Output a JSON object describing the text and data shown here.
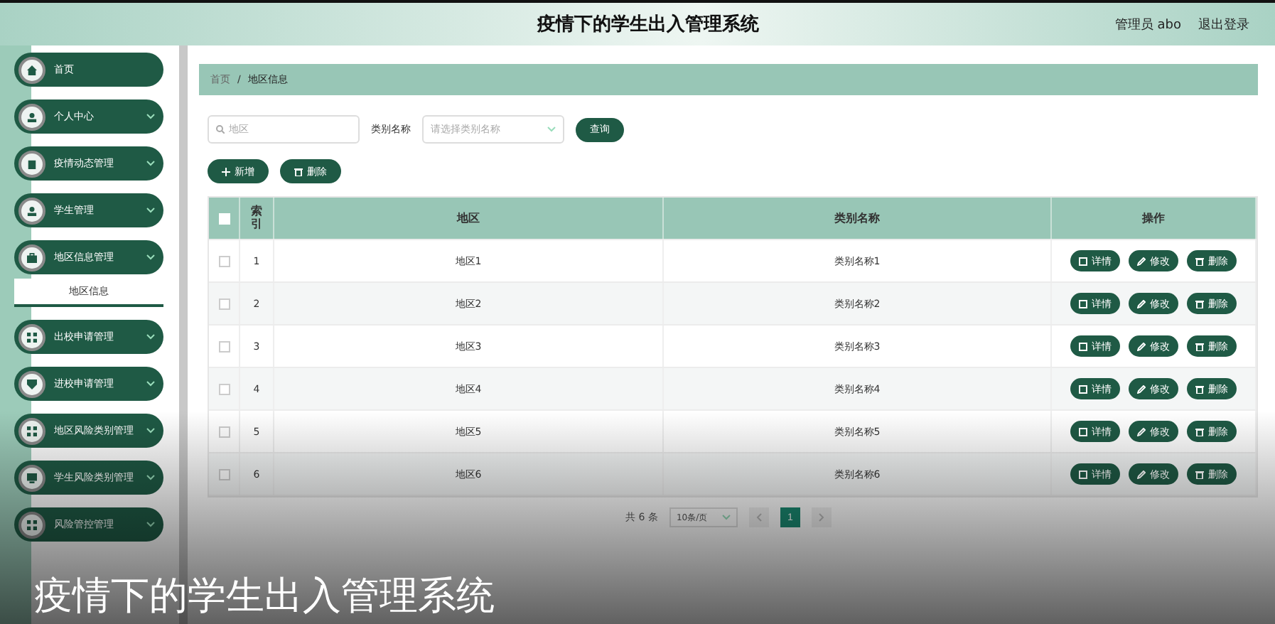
{
  "header": {
    "title": "疫情下的学生出入管理系统",
    "user": "管理员 abo",
    "logout": "退出登录"
  },
  "sidebar": {
    "items": [
      {
        "label": "首页"
      },
      {
        "label": "个人中心"
      },
      {
        "label": "疫情动态管理"
      },
      {
        "label": "学生管理"
      },
      {
        "label": "地区信息管理",
        "children": [
          {
            "label": "地区信息",
            "selected": true
          }
        ]
      },
      {
        "label": "出校申请管理"
      },
      {
        "label": "进校申请管理"
      },
      {
        "label": "地区风险类别管理"
      },
      {
        "label": "学生风险类别管理"
      },
      {
        "label": "风险管控管理"
      }
    ]
  },
  "breadcrumb": {
    "items": [
      "首页",
      "地区信息"
    ],
    "separator": "/"
  },
  "search": {
    "placeholder": "地区",
    "category_label": "类别名称",
    "category_placeholder": "请选择类别名称",
    "button": "查询"
  },
  "actions": [
    "新增",
    "删除"
  ],
  "table": {
    "columns": [
      "索引",
      "地区",
      "类别名称",
      "操作"
    ],
    "all_checked": false,
    "rows": [
      {
        "index": "1",
        "region": "地区1",
        "category": "类别名称1",
        "checked": false,
        "actions": [
          "详情",
          "修改",
          "删除"
        ]
      },
      {
        "index": "2",
        "region": "地区2",
        "category": "类别名称2",
        "checked": false,
        "actions": [
          "详情",
          "修改",
          "删除"
        ]
      },
      {
        "index": "3",
        "region": "地区3",
        "category": "类别名称3",
        "checked": false,
        "actions": [
          "详情",
          "修改",
          "删除"
        ]
      },
      {
        "index": "4",
        "region": "地区4",
        "category": "类别名称4",
        "checked": false,
        "actions": [
          "详情",
          "修改",
          "删除"
        ]
      },
      {
        "index": "5",
        "region": "地区5",
        "category": "类别名称5",
        "checked": false,
        "actions": [
          "详情",
          "修改",
          "删除"
        ]
      },
      {
        "index": "6",
        "region": "地区6",
        "category": "类别名称6",
        "checked": false,
        "actions": [
          "详情",
          "修改",
          "删除"
        ]
      }
    ]
  },
  "pagination": {
    "total": "共 6 条",
    "page_size": "10条/页",
    "pages": [
      {
        "label": "1",
        "selected": true
      }
    ]
  },
  "caption": "疫情下的学生出入管理系统"
}
